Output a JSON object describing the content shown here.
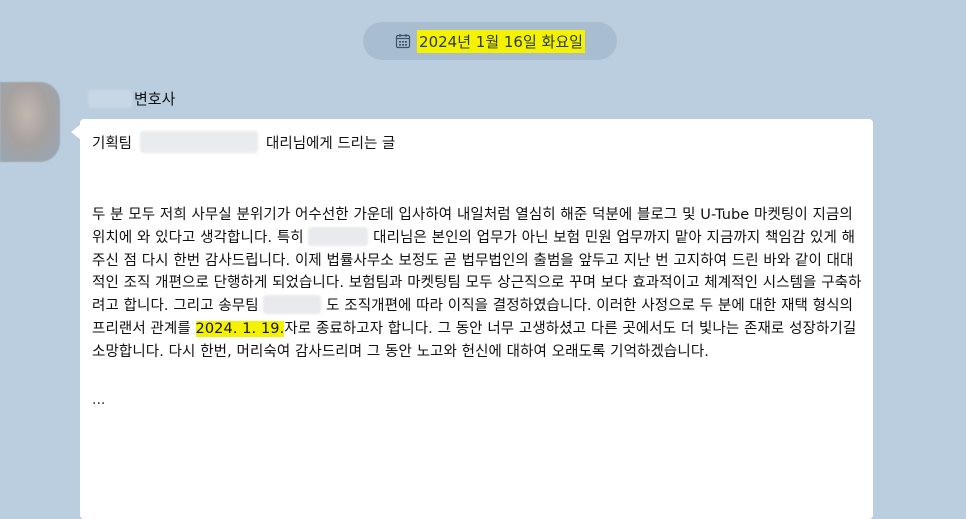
{
  "date_divider": {
    "icon": "calendar-icon",
    "text": "2024년 1월 16일 화요일",
    "highlight_color": "#f4f200"
  },
  "message": {
    "sender": "변호사",
    "greeting_prefix": "기획팀",
    "greeting_suffix": "대리님에게 드리는 글",
    "body": {
      "seg1": "두 분 모두 저희 사무실 분위기가 어수선한 가운데 입사하여 내일처럼 열심히 해준 덕분에 블로그 및 U-Tube 마켓팅이 지금의 위치에 와 있다고 생각합니다. 특히",
      "seg2": "대리님은 본인의 업무가 아닌 보험 민원 업무까지 맡아 지금까지 책임감 있게 해주신 점 다시 한번 감사드립니다. 이제 법률사무소 보정도 곧 법무법인의 출범을 앞두고 지난 번 고지하여 드린 바와 같이 대대적인 조직 개편으로 단행하게 되었습니다. 보험팀과 마켓팅팀 모두 상근직으로 꾸며 보다 효과적이고 체계적인 시스템을 구축하려고 합니다. 그리고 송무팀",
      "seg3": "도 조직개편에 따라 이직을 결정하였습니다. 이러한 사정으로 두 분에 대한 재택 형식의 프리랜서 관계를",
      "date": "2024. 1. 19.",
      "seg4": "자로 종료하고자 합니다. 그 동안 너무 고생하셨고 다른 곳에서도 더 빛나는 존재로 성장하기길 소망합니다. 다시 한번, 머리숙여 감사드리며 그 동안 노고와 헌신에 대하여 오래도록 기억하겠습니다."
    },
    "ellipsis": "..."
  },
  "colors": {
    "background": "#bacee0",
    "bubble": "#ffffff",
    "highlight": "#f4f200"
  }
}
